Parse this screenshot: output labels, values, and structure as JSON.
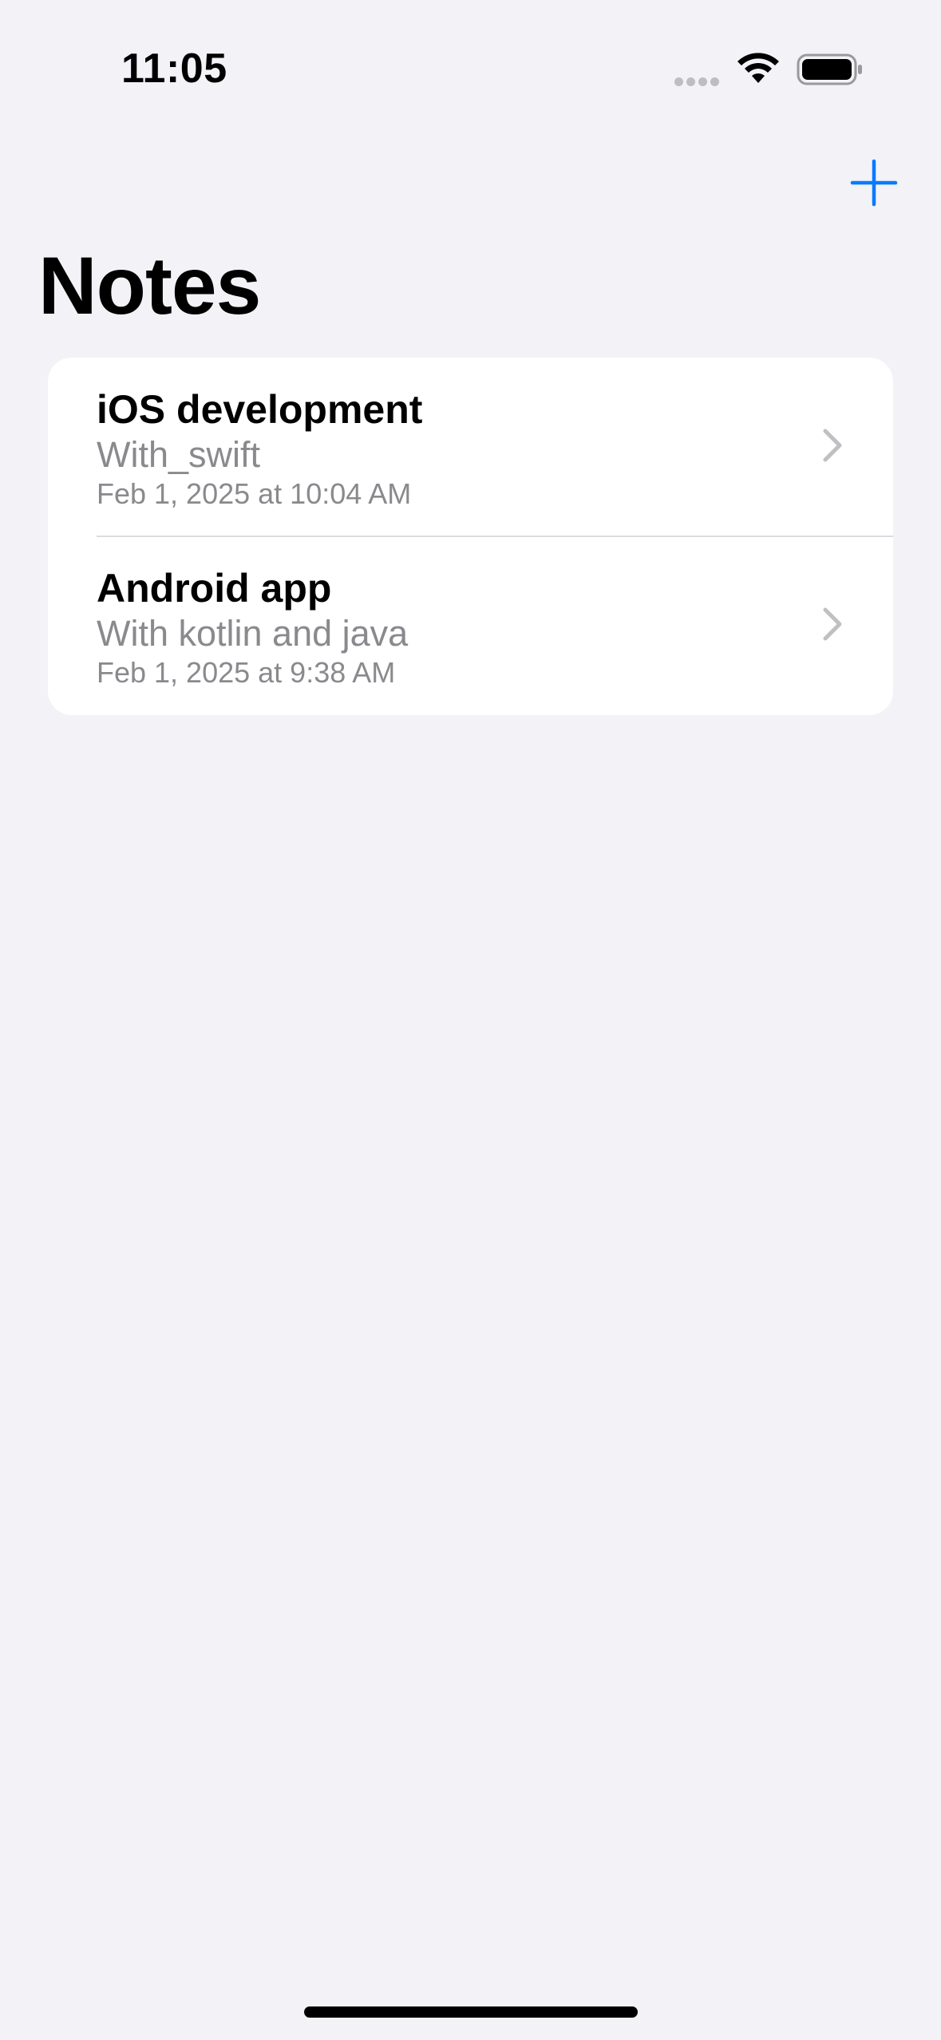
{
  "status_bar": {
    "time": "11:05",
    "signal_icon": "cellular-dots-icon",
    "wifi_icon": "wifi-icon",
    "battery_icon": "battery-icon"
  },
  "nav": {
    "add_icon": "plus-icon",
    "title": "Notes",
    "accent_color": "#0A7AFF"
  },
  "notes": [
    {
      "title": "iOS development",
      "subtitle": "With_swift",
      "date": "Feb 1, 2025 at 10:04 AM",
      "icon": "chevron-right-icon"
    },
    {
      "title": "Android app",
      "subtitle": "With kotlin and java",
      "date": "Feb 1, 2025 at 9:38 AM",
      "icon": "chevron-right-icon"
    }
  ],
  "colors": {
    "background": "#F2F2F7",
    "card": "#FFFFFF",
    "secondary_text": "#8A8A8E"
  }
}
